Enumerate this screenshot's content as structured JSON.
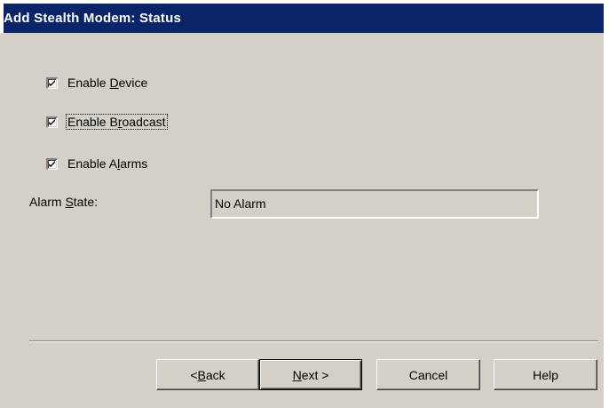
{
  "window": {
    "title": "Add Stealth Modem: Status"
  },
  "options": {
    "enable_device": {
      "prefix": "Enable ",
      "mnemonic": "D",
      "suffix": "evice",
      "checked": true
    },
    "enable_broadcast": {
      "prefix": "Enable B",
      "mnemonic": "r",
      "suffix": "oadcast",
      "checked": true
    },
    "enable_alarms": {
      "prefix": "Enable A",
      "mnemonic": "l",
      "suffix": "arms",
      "checked": true
    }
  },
  "alarm_state": {
    "label_prefix": "Alarm ",
    "label_mnemonic": "S",
    "label_suffix": "tate:",
    "value": "No Alarm"
  },
  "buttons": {
    "back": {
      "prefix": "< ",
      "mnemonic": "B",
      "suffix": "ack"
    },
    "next": {
      "prefix": "",
      "mnemonic": "N",
      "suffix": "ext >"
    },
    "cancel": {
      "label": "Cancel"
    },
    "help": {
      "label": "Help"
    }
  },
  "colors": {
    "titlebar": "#0a246a",
    "dialog_face": "#d4d0c8"
  }
}
